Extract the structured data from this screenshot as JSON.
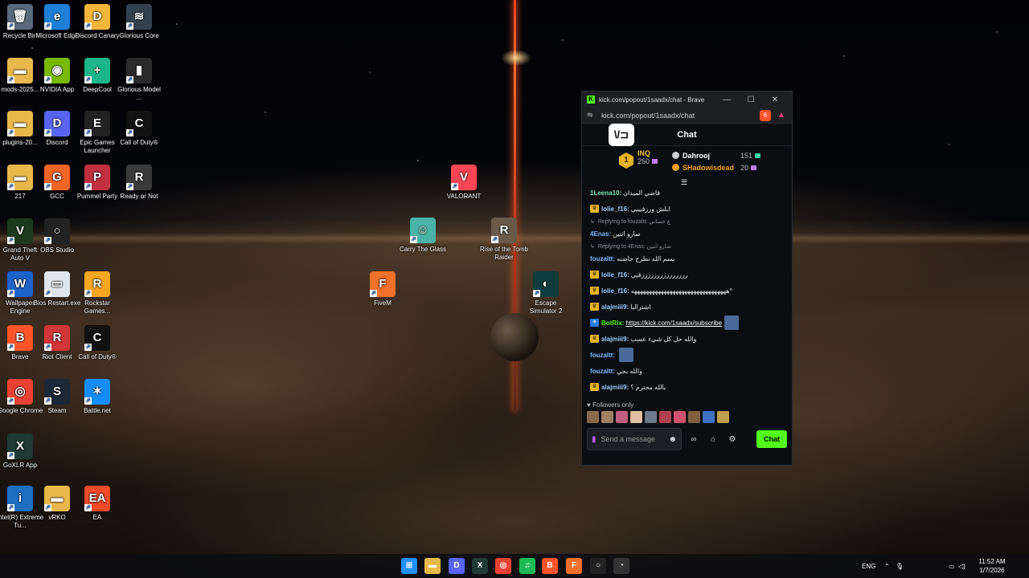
{
  "desktop": {
    "icons": [
      {
        "label": "Recycle Bin",
        "glyph": "🗑",
        "color": "#5a6a7a"
      },
      {
        "label": "Microsoft Edge",
        "glyph": "e",
        "color": "#1e7fd6"
      },
      {
        "label": "Discord Canary",
        "glyph": "D",
        "color": "#f4b63a"
      },
      {
        "label": "Glorious Core",
        "glyph": "≋",
        "color": "#33414f"
      },
      {
        "label": "mods-2025...",
        "glyph": "▬",
        "color": "#e8b84a"
      },
      {
        "label": "NVIDIA App",
        "glyph": "◉",
        "color": "#76b900"
      },
      {
        "label": "DeepCool",
        "glyph": "+",
        "color": "#1db68c"
      },
      {
        "label": "Glorious Model ...",
        "glyph": "▮",
        "color": "#2b2b2b"
      },
      {
        "label": "plugins-20...",
        "glyph": "▬",
        "color": "#e8b84a"
      },
      {
        "label": "Discord",
        "glyph": "D",
        "color": "#5865f2"
      },
      {
        "label": "Epic Games Launcher",
        "glyph": "E",
        "color": "#222"
      },
      {
        "label": "Call of Duty®",
        "glyph": "C",
        "color": "#111"
      },
      {
        "label": "217",
        "glyph": "▬",
        "color": "#e8b84a"
      },
      {
        "label": "GCC",
        "glyph": "G",
        "color": "#f06424"
      },
      {
        "label": "Pummel Party",
        "glyph": "P",
        "color": "#c03040"
      },
      {
        "label": "Ready or Not",
        "glyph": "R",
        "color": "#3a3a3a"
      },
      {
        "label": "Grand Theft Auto V",
        "glyph": "V",
        "color": "#1c3b1c"
      },
      {
        "label": "OBS Studio",
        "glyph": "○",
        "color": "#222"
      },
      {
        "label": "Wallpaper Engine",
        "glyph": "W",
        "color": "#1f62c7"
      },
      {
        "label": "Bios Restart.exe",
        "glyph": "▭",
        "color": "#dfe6ee"
      },
      {
        "label": "Rockstar Games...",
        "glyph": "R",
        "color": "#f5a623"
      },
      {
        "label": "Brave",
        "glyph": "B",
        "color": "#fb542b"
      },
      {
        "label": "Riot Client",
        "glyph": "R",
        "color": "#d13639"
      },
      {
        "label": "Call of Duty®",
        "glyph": "C",
        "color": "#111"
      },
      {
        "label": "Google Chrome",
        "glyph": "◎",
        "color": "#e94235"
      },
      {
        "label": "Steam",
        "glyph": "S",
        "color": "#1b2838"
      },
      {
        "label": "Battle.net",
        "glyph": "✶",
        "color": "#148eff"
      },
      {
        "label": "GoXLR App",
        "glyph": "X",
        "color": "#1e3a32"
      },
      {
        "label": "Intel(R) Extreme Tu...",
        "glyph": "i",
        "color": "#1d6fc2"
      },
      {
        "label": "vRKO",
        "glyph": "▬",
        "color": "#e8b84a"
      },
      {
        "label": "EA",
        "glyph": "EA",
        "color": "#ef4a2a"
      },
      {
        "label": "VALORANT",
        "glyph": "V",
        "color": "#ff4655"
      },
      {
        "label": "Carry The Glass",
        "glyph": "☺",
        "color": "#4ab3a8"
      },
      {
        "label": "Rise of the Tomb Raider",
        "glyph": "R",
        "color": "#6a5a4a"
      },
      {
        "label": "FiveM",
        "glyph": "F",
        "color": "#f1702a"
      },
      {
        "label": "Escape Simulator 2",
        "glyph": "◐",
        "color": "#0e3b3b"
      }
    ]
  },
  "browser": {
    "title": "kick.com/popout/1saadx/chat - Brave",
    "url": "kick.com/popout/1saadx/chat",
    "brave_badge": "6",
    "controls": {
      "minimize": "—",
      "maximize": "☐",
      "close": "✕"
    }
  },
  "chat": {
    "header_title": "Chat",
    "logo_text": "\\/⊐",
    "leaderboard": {
      "rank": "1",
      "top_name": "INQ",
      "top_count": "250",
      "others": [
        {
          "name": "Dahrooj",
          "count": "151",
          "name_color": "#ffffff",
          "gift_color": "#3ad6a8"
        },
        {
          "name": "SHadowisdead",
          "count": "20",
          "name_color": "#f0a020",
          "gift_color": "#c07ef0"
        }
      ]
    },
    "messages": [
      {
        "kind": "msg",
        "user": "1Leena10:",
        "color": "#7ee8b8",
        "badge": false,
        "text": "قاضي الميدان",
        "emote": false
      },
      {
        "kind": "msg",
        "user": "lolie_f16:",
        "color": "#9ec9ff",
        "badge": true,
        "text": "ابلش ورزفيييي",
        "emote": false
      },
      {
        "kind": "reply",
        "text": "Replying to fouzaltt: ع حسابي"
      },
      {
        "kind": "msg",
        "user": "4Enas:",
        "color": "#7ab8ff",
        "badge": false,
        "text": "صارو اثنين",
        "emote": false
      },
      {
        "kind": "reply",
        "text": "Replying to 4Enas: صارو اثنين"
      },
      {
        "kind": "msg",
        "user": "fouzaltt:",
        "color": "#7ab8ff",
        "badge": false,
        "text": "بسم الله نطرح حاضنه",
        "emote": false
      },
      {
        "kind": "msg",
        "user": "lolie_f16:",
        "color": "#9ec9ff",
        "badge": true,
        "text": "ررررررررررزززززقيي",
        "emote": false
      },
      {
        "kind": "msg",
        "user": "lolie_f16:",
        "color": "#9ec9ff",
        "badge": true,
        "text": "ههههههههههههههههههههههههههههههههه^",
        "emote": false
      },
      {
        "kind": "msg",
        "user": "alajmiii9:",
        "color": "#9ec9ff",
        "badge": true,
        "text": "اشترالبا",
        "emote": false
      },
      {
        "kind": "msg",
        "user": "BotRix:",
        "color": "#53fc18",
        "badge": true,
        "text": "https://kick.com/1saadx/subscribe",
        "emote": true,
        "link": true
      },
      {
        "kind": "msg",
        "user": "alajmiii9:",
        "color": "#9ec9ff",
        "badge": true,
        "text": "والله حل كل شيء عسب",
        "emote": false
      },
      {
        "kind": "msg",
        "user": "fouzaltt:",
        "color": "#7ab8ff",
        "badge": false,
        "text": "",
        "emote": true
      },
      {
        "kind": "msg",
        "user": "fouzaltt:",
        "color": "#7ab8ff",
        "badge": false,
        "text": "والله بجي",
        "emote": false
      },
      {
        "kind": "msg",
        "user": "alajmiii9:",
        "color": "#9ec9ff",
        "badge": true,
        "text": "يالله محترم ؟",
        "emote": false
      }
    ],
    "followers_label": "Followers only",
    "emote_colors": [
      "#8a6a4a",
      "#a08060",
      "#c06080",
      "#e0c0a0",
      "#6a7a8a",
      "#b04050",
      "#d05070",
      "#806040",
      "#4070c0",
      "#c0a050"
    ],
    "input": {
      "placeholder": "Send a message",
      "send_label": "Chat"
    }
  },
  "taskbar": {
    "apps": [
      {
        "name": "start",
        "glyph": "⊞",
        "color": "#1e90ff"
      },
      {
        "name": "file-explorer",
        "glyph": "▬",
        "color": "#e8b84a"
      },
      {
        "name": "discord",
        "glyph": "D",
        "color": "#5865f2"
      },
      {
        "name": "goxlr",
        "glyph": "X",
        "color": "#1e3a32"
      },
      {
        "name": "chrome",
        "glyph": "◎",
        "color": "#e94235"
      },
      {
        "name": "spotify",
        "glyph": "♫",
        "color": "#1db954"
      },
      {
        "name": "brave",
        "glyph": "B",
        "color": "#fb542b"
      },
      {
        "name": "fivem",
        "glyph": "F",
        "color": "#f1702a"
      },
      {
        "name": "obs",
        "glyph": "○",
        "color": "#222"
      },
      {
        "name": "app",
        "glyph": "◔",
        "color": "#333"
      }
    ],
    "lang": "ENG",
    "time": "11:52 AM",
    "date": "1/7/2026"
  }
}
